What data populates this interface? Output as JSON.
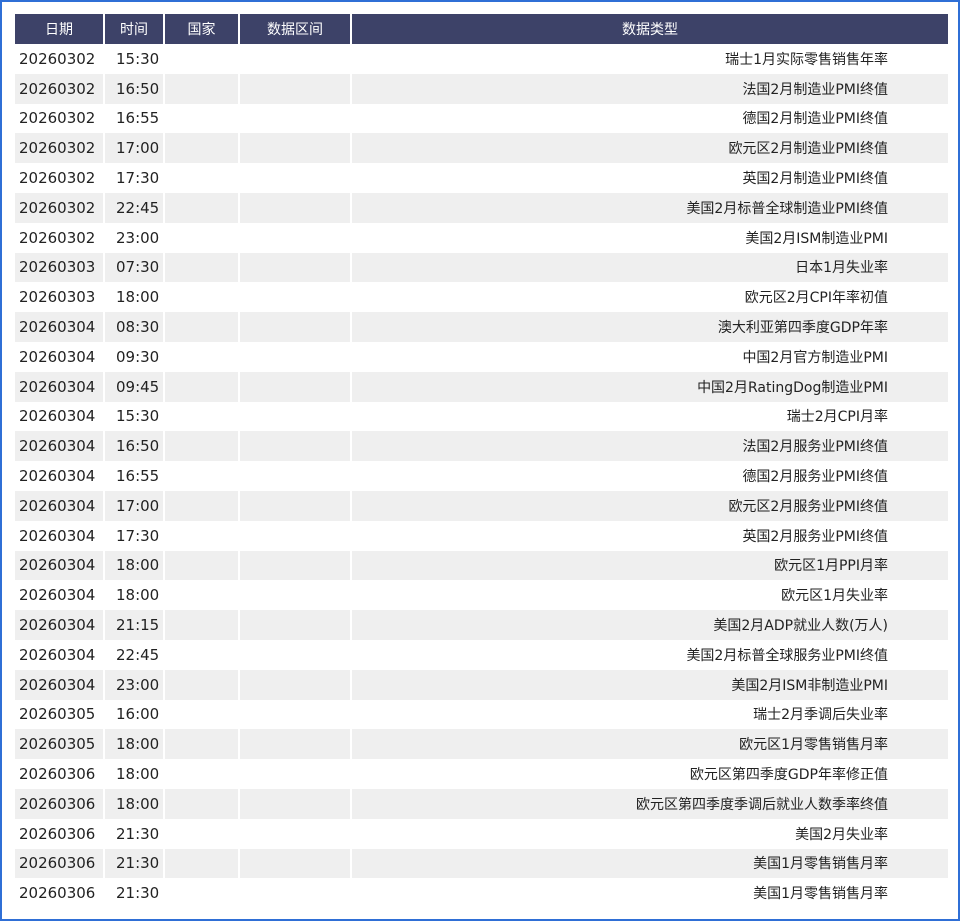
{
  "headers": [
    "日期",
    "时间",
    "国家",
    "数据区间",
    "数据类型"
  ],
  "rows": [
    {
      "date": "20260302",
      "time": "15:30",
      "country": "",
      "range": "",
      "type": "瑞士1月实际零售销售年率"
    },
    {
      "date": "20260302",
      "time": "16:50",
      "country": "",
      "range": "",
      "type": "法国2月制造业PMI终值"
    },
    {
      "date": "20260302",
      "time": "16:55",
      "country": "",
      "range": "",
      "type": "德国2月制造业PMI终值"
    },
    {
      "date": "20260302",
      "time": "17:00",
      "country": "",
      "range": "",
      "type": "欧元区2月制造业PMI终值"
    },
    {
      "date": "20260302",
      "time": "17:30",
      "country": "",
      "range": "",
      "type": "英国2月制造业PMI终值"
    },
    {
      "date": "20260302",
      "time": "22:45",
      "country": "",
      "range": "",
      "type": "美国2月标普全球制造业PMI终值"
    },
    {
      "date": "20260302",
      "time": "23:00",
      "country": "",
      "range": "",
      "type": "美国2月ISM制造业PMI"
    },
    {
      "date": "20260303",
      "time": "07:30",
      "country": "",
      "range": "",
      "type": "日本1月失业率"
    },
    {
      "date": "20260303",
      "time": "18:00",
      "country": "",
      "range": "",
      "type": "欧元区2月CPI年率初值"
    },
    {
      "date": "20260304",
      "time": "08:30",
      "country": "",
      "range": "",
      "type": "澳大利亚第四季度GDP年率"
    },
    {
      "date": "20260304",
      "time": "09:30",
      "country": "",
      "range": "",
      "type": "中国2月官方制造业PMI"
    },
    {
      "date": "20260304",
      "time": "09:45",
      "country": "",
      "range": "",
      "type": "中国2月RatingDog制造业PMI"
    },
    {
      "date": "20260304",
      "time": "15:30",
      "country": "",
      "range": "",
      "type": "瑞士2月CPI月率"
    },
    {
      "date": "20260304",
      "time": "16:50",
      "country": "",
      "range": "",
      "type": "法国2月服务业PMI终值"
    },
    {
      "date": "20260304",
      "time": "16:55",
      "country": "",
      "range": "",
      "type": "德国2月服务业PMI终值"
    },
    {
      "date": "20260304",
      "time": "17:00",
      "country": "",
      "range": "",
      "type": "欧元区2月服务业PMI终值"
    },
    {
      "date": "20260304",
      "time": "17:30",
      "country": "",
      "range": "",
      "type": "英国2月服务业PMI终值"
    },
    {
      "date": "20260304",
      "time": "18:00",
      "country": "",
      "range": "",
      "type": "欧元区1月PPI月率"
    },
    {
      "date": "20260304",
      "time": "18:00",
      "country": "",
      "range": "",
      "type": "欧元区1月失业率"
    },
    {
      "date": "20260304",
      "time": "21:15",
      "country": "",
      "range": "",
      "type": "美国2月ADP就业人数(万人)"
    },
    {
      "date": "20260304",
      "time": "22:45",
      "country": "",
      "range": "",
      "type": "美国2月标普全球服务业PMI终值"
    },
    {
      "date": "20260304",
      "time": "23:00",
      "country": "",
      "range": "",
      "type": "美国2月ISM非制造业PMI"
    },
    {
      "date": "20260305",
      "time": "16:00",
      "country": "",
      "range": "",
      "type": "瑞士2月季调后失业率"
    },
    {
      "date": "20260305",
      "time": "18:00",
      "country": "",
      "range": "",
      "type": "欧元区1月零售销售月率"
    },
    {
      "date": "20260306",
      "time": "18:00",
      "country": "",
      "range": "",
      "type": "欧元区第四季度GDP年率修正值"
    },
    {
      "date": "20260306",
      "time": "18:00",
      "country": "",
      "range": "",
      "type": "欧元区第四季度季调后就业人数季率终值"
    },
    {
      "date": "20260306",
      "time": "21:30",
      "country": "",
      "range": "",
      "type": "美国2月失业率"
    },
    {
      "date": "20260306",
      "time": "21:30",
      "country": "",
      "range": "",
      "type": "美国1月零售销售月率"
    },
    {
      "date": "20260306",
      "time": "21:30",
      "country": "",
      "range": "",
      "type": "美国1月零售销售月率"
    }
  ],
  "colors": {
    "header_bg": "#3d4268",
    "header_text": "#ffffff",
    "stripe": "#efefef",
    "frame_border": "#2f6fd6"
  }
}
